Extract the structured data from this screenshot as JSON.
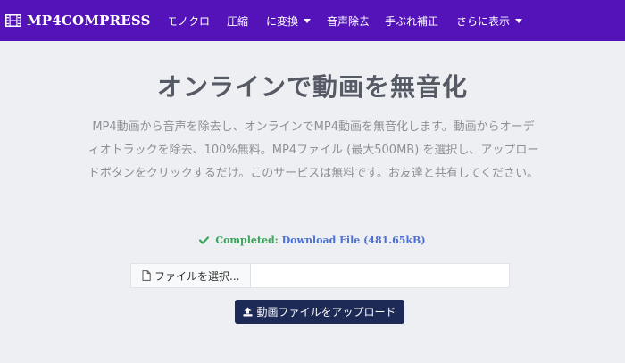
{
  "navbar": {
    "brand": "MP4COMPRESS",
    "brand_icon": "film-icon",
    "items": [
      {
        "label": "モノクロ",
        "dropdown": false
      },
      {
        "label": "圧縮",
        "dropdown": false
      },
      {
        "label": "に変換",
        "dropdown": true
      },
      {
        "label": "音声除去",
        "dropdown": false
      },
      {
        "label": "手ぶれ補正",
        "dropdown": false
      },
      {
        "label": "さらに表示",
        "dropdown": true
      }
    ],
    "background_color": "#5313b8"
  },
  "main": {
    "heading": "オンラインで動画を無音化",
    "description": "MP4動画から音声を除去し、オンラインでMP4動画を無音化します。動画からオーディオトラックを除去、100%無料。MP4ファイル (最大500MB) を選択し、アップロードボタンをクリックするだけ。このサービスは無料です。お友達と共有してください。",
    "status": {
      "icon": "check-icon",
      "completed_label": "Completed:",
      "download_label": "Download File (481.65kB)",
      "completed_color": "#3aa55a",
      "link_color": "#4d6fd1"
    },
    "file_input": {
      "button_label": "ファイルを選択...",
      "button_icon": "file-icon",
      "value": ""
    },
    "upload_button": {
      "label": "動画ファイルをアップロード",
      "icon": "upload-icon",
      "color": "#1d2a55"
    }
  }
}
